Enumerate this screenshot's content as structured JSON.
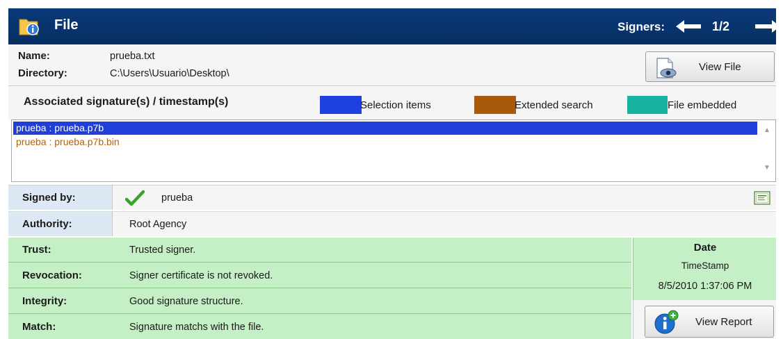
{
  "header": {
    "title": "File",
    "signers_label": "Signers:",
    "counter": "1/2"
  },
  "file_info": {
    "name_label": "Name:",
    "name_value": "prueba.txt",
    "directory_label": "Directory:",
    "directory_value": "C:\\Users\\Usuario\\Desktop\\",
    "view_file_button": "View File"
  },
  "associated": {
    "heading": "Associated signature(s) / timestamp(s)",
    "legend": [
      {
        "label": "Selection items",
        "color": "#1e40e0"
      },
      {
        "label": "Extended search",
        "color": "#a85a0a"
      },
      {
        "label": "File embedded",
        "color": "#16b3a0"
      }
    ],
    "items": [
      {
        "text": "prueba : prueba.p7b",
        "selected": true
      },
      {
        "text": "prueba : prueba.p7b.bin",
        "selected": false
      }
    ]
  },
  "details": {
    "signed_by_label": "Signed by:",
    "signed_by_value": "prueba",
    "authority_label": "Authority:",
    "authority_value": "Root Agency",
    "trust_label": "Trust:",
    "trust_value": "Trusted signer.",
    "revocation_label": "Revocation:",
    "revocation_value": "Signer certificate is not revoked.",
    "integrity_label": "Integrity:",
    "integrity_value": "Good signature structure.",
    "match_label": "Match:",
    "match_value": "Signature matchs with the file."
  },
  "date_panel": {
    "heading": "Date",
    "timestamp_label": "TimeStamp",
    "date_value": "8/5/2010 1:37:06 PM",
    "view_report_button": "View Report"
  },
  "colors": {
    "header_bg": "#0a3a78",
    "status_green": "#c5efc5",
    "selection_blue": "#1f3fd8",
    "extended_brown": "#b06010"
  }
}
